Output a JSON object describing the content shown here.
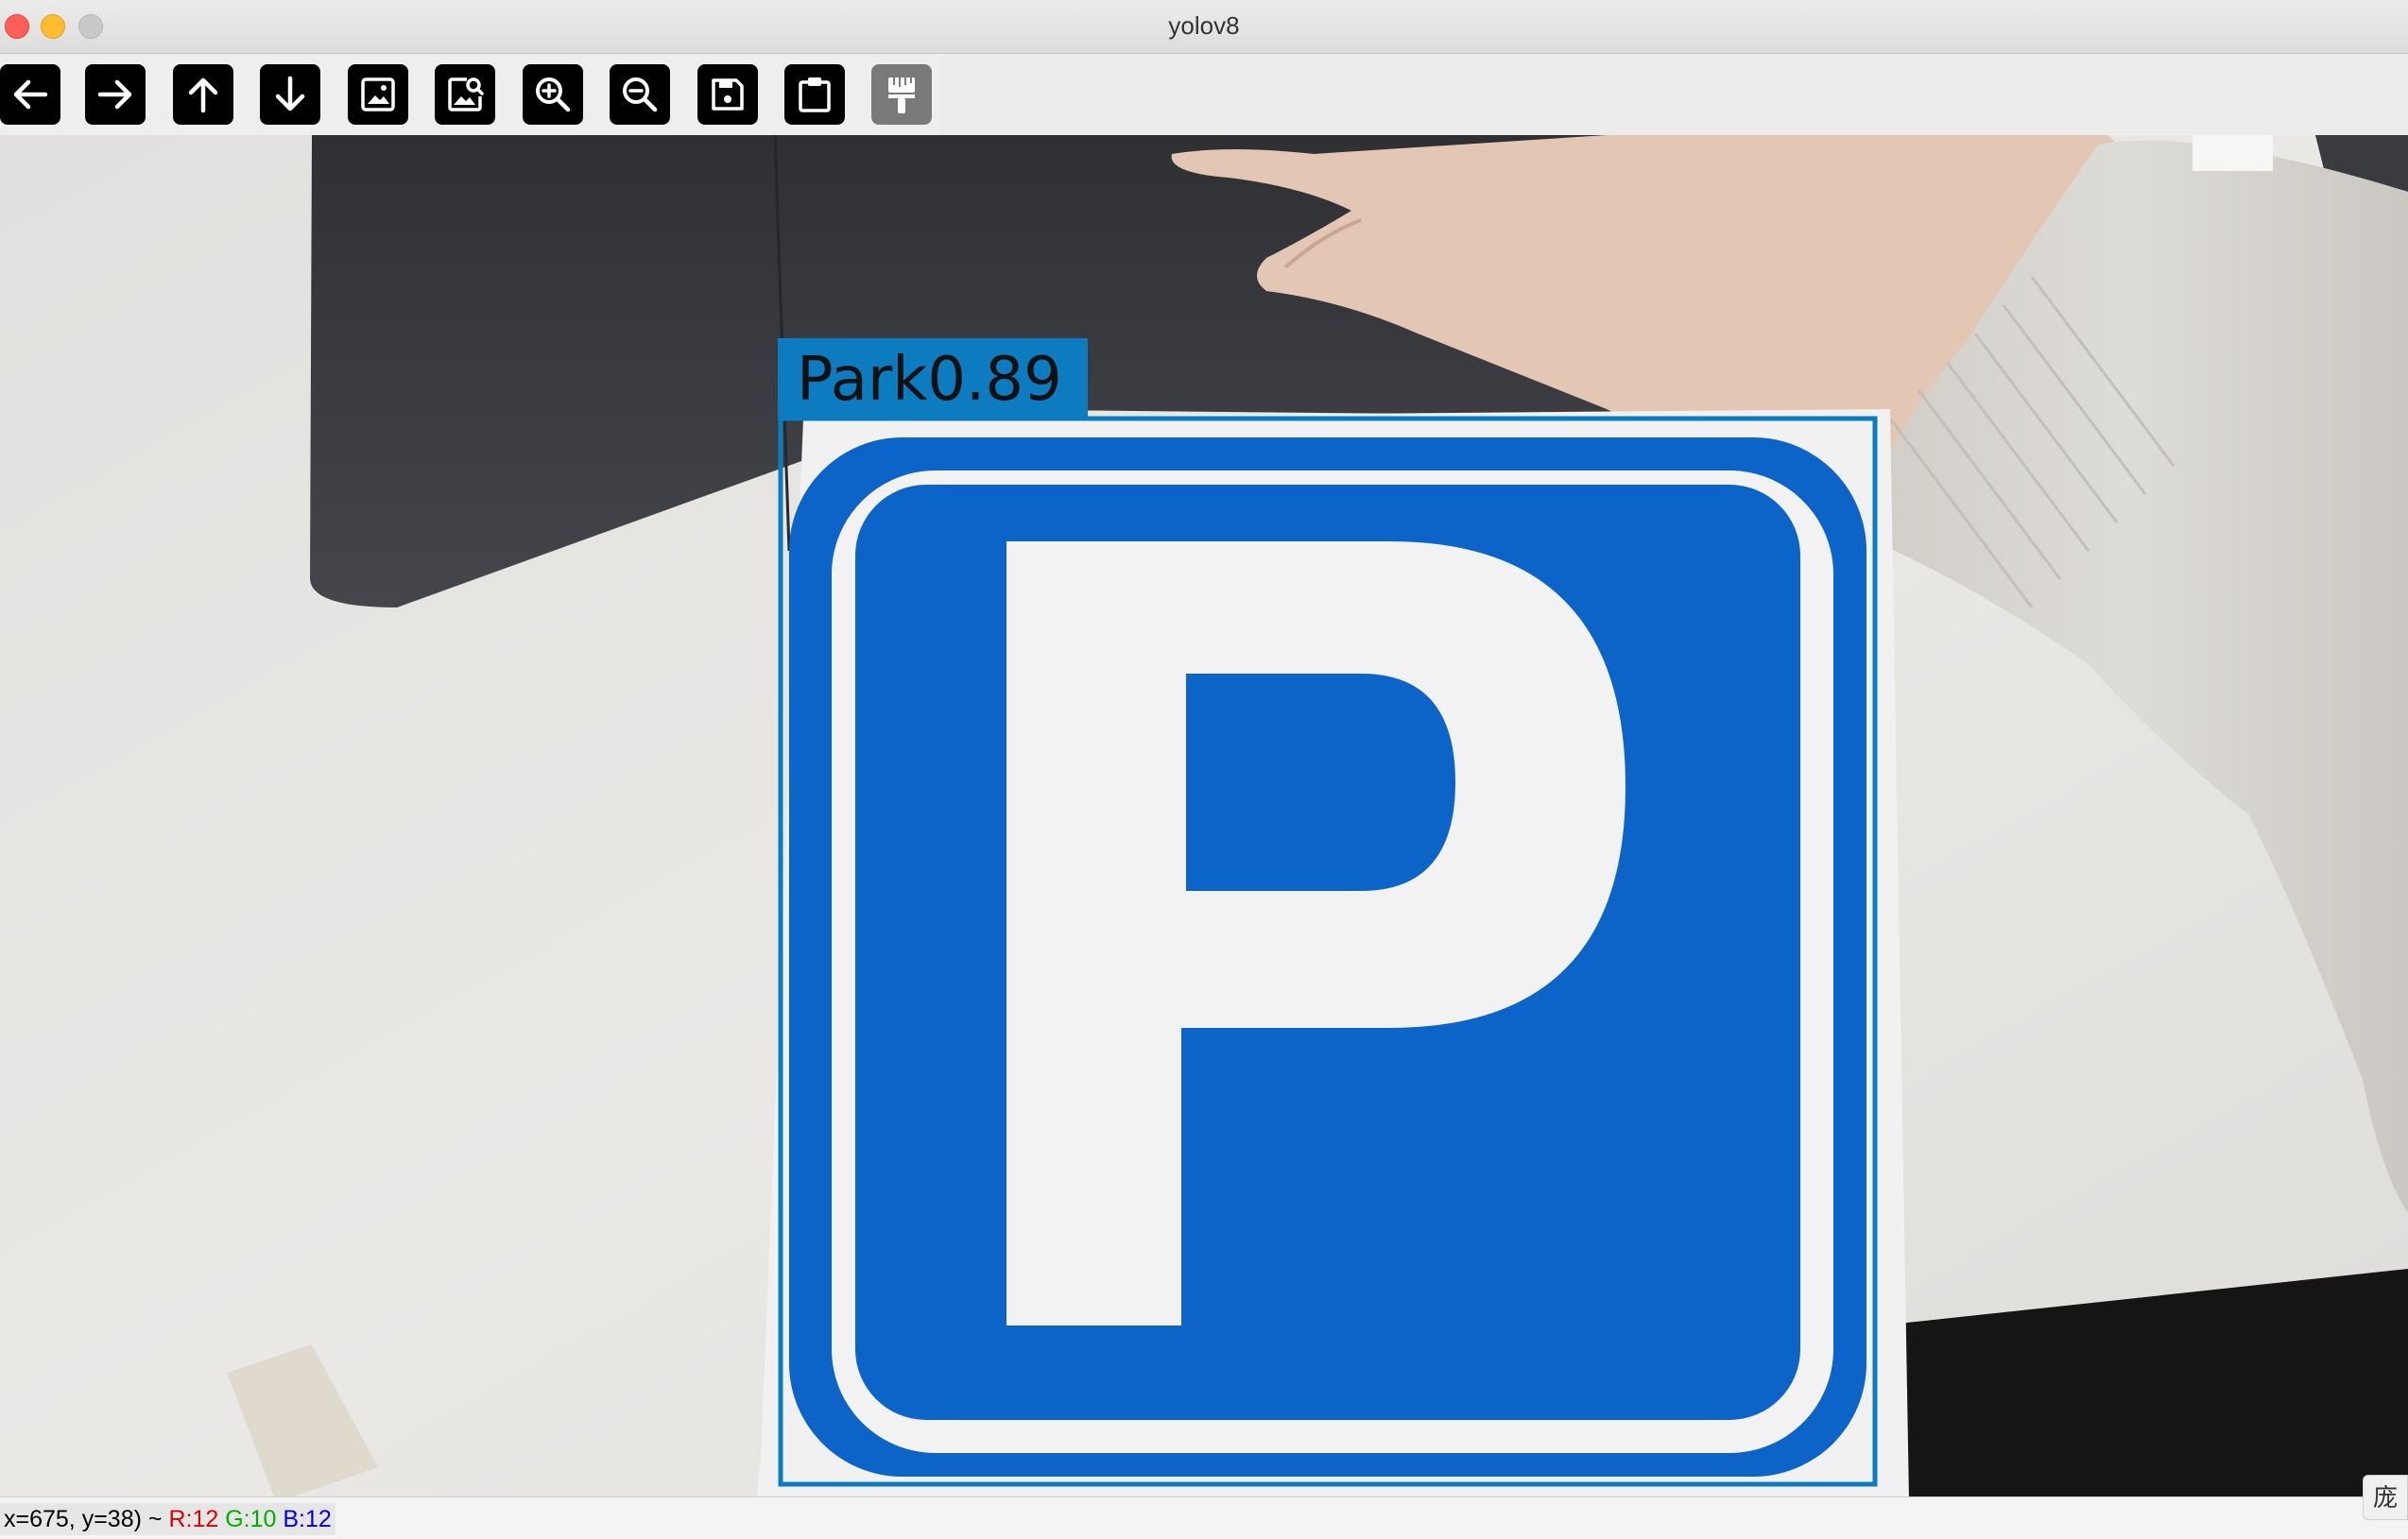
{
  "window": {
    "title": "yolov8"
  },
  "toolbar": {
    "buttons": [
      {
        "name": "back",
        "icon": "arrow-left-icon",
        "enabled": true
      },
      {
        "name": "forward",
        "icon": "arrow-right-icon",
        "enabled": true
      },
      {
        "name": "up",
        "icon": "arrow-up-icon",
        "enabled": true
      },
      {
        "name": "down",
        "icon": "arrow-down-icon",
        "enabled": true
      },
      {
        "name": "image",
        "icon": "image-icon",
        "enabled": true
      },
      {
        "name": "image-zoom",
        "icon": "image-search-icon",
        "enabled": true
      },
      {
        "name": "zoom-in",
        "icon": "zoom-in-icon",
        "enabled": true
      },
      {
        "name": "zoom-out",
        "icon": "zoom-out-icon",
        "enabled": true
      },
      {
        "name": "save",
        "icon": "save-icon",
        "enabled": true
      },
      {
        "name": "copy",
        "icon": "clipboard-icon",
        "enabled": true
      },
      {
        "name": "properties",
        "icon": "paint-brush-icon",
        "enabled": false
      }
    ]
  },
  "detection": {
    "label": "Park0.89",
    "box_color": "#0c7bc0"
  },
  "status": {
    "coords": "x=675, y=38) ~ ",
    "r": "R:12",
    "g": "G:10",
    "b": "B:12"
  },
  "corner_button": {
    "label": "庞"
  },
  "colors": {
    "sign_blue": "#0c63c8",
    "sign_white": "#f2f2f2",
    "laptop": "#3b3c40",
    "desk": "#e8e6e3"
  }
}
